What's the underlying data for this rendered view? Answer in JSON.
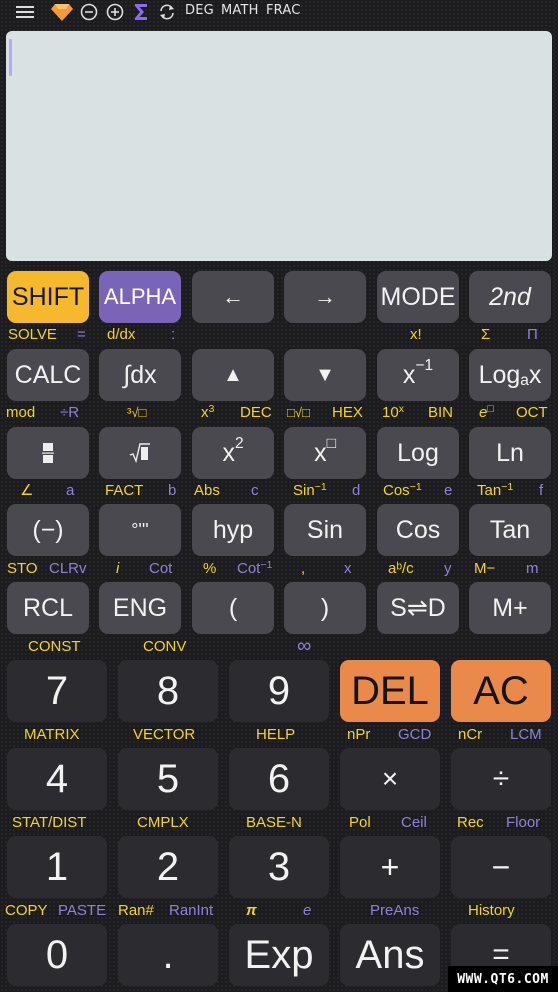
{
  "topbar": {
    "icons": [
      "menu-icon",
      "premium-gem-icon",
      "zoom-out-icon",
      "zoom-in-icon",
      "sigma-icon",
      "refresh-icon"
    ],
    "mode_angle": "DEG",
    "mode_input": "MATH",
    "mode_output": "FRAC"
  },
  "display": {
    "value": ""
  },
  "row1": {
    "keys": [
      "SHIFT",
      "ALPHA",
      "←",
      "→",
      "MODE",
      "2nd"
    ],
    "labels": {
      "solve": "SOLVE",
      "eq": "=",
      "ddx": "d/dx",
      "colon": ":",
      "fact": "x!",
      "sum": "Σ",
      "prod": "Π"
    }
  },
  "row2": {
    "keys": {
      "calc": "CALC",
      "integ": "∫dx",
      "up": "▲",
      "down": "▼",
      "inv_base": "x",
      "inv_exp": "−1",
      "loga_base": "Log",
      "loga_sub": "a",
      "loga_x": "x"
    },
    "labels": {
      "mod": "mod",
      "divr": "÷R",
      "cbrt": "³√□",
      "cube_base": "x",
      "cube_exp": "3",
      "dec": "DEC",
      "nroot": "□√□",
      "hex": "HEX",
      "ten_base": "10",
      "ten_exp": "x",
      "bin": "BIN",
      "e_base": "e",
      "e_exp": "□",
      "oct": "OCT"
    }
  },
  "row3": {
    "keys": {
      "frac": "▪",
      "sqrt": "√▪",
      "sq_base": "x",
      "sq_exp": "2",
      "pow_base": "x",
      "pow_exp": "□",
      "log": "Log",
      "ln": "Ln"
    },
    "labels": {
      "angle": "∠",
      "a": "a",
      "fact": "FACT",
      "b": "b",
      "abs": "Abs",
      "c": "c",
      "asin": "Sin",
      "d": "d",
      "acos": "Cos",
      "e": "e",
      "atan": "Tan",
      "f": "f",
      "inv": "−1"
    }
  },
  "row4": {
    "keys": [
      "(−)",
      "°'''",
      "hyp",
      "Sin",
      "Cos",
      "Tan"
    ],
    "labels": {
      "sto": "STO",
      "clrv": "CLRv",
      "i": "i",
      "cot": "Cot",
      "pct": "%",
      "acot": "Cot",
      "acot_exp": "−1",
      "comma": ",",
      "x": "x",
      "abc": "aᵇ/c",
      "y": "y",
      "mminus": "M−",
      "m": "m"
    }
  },
  "row5": {
    "keys": [
      "RCL",
      "ENG",
      "(",
      ")",
      "S⇌D",
      "M+"
    ],
    "labels": {
      "const": "CONST",
      "conv": "CONV",
      "inf": "∞"
    }
  },
  "row6": {
    "keys": [
      "7",
      "8",
      "9",
      "DEL",
      "AC"
    ],
    "labels": {
      "matrix": "MATRIX",
      "vector": "VECTOR",
      "help": "HELP",
      "npr": "nPr",
      "gcd": "GCD",
      "ncr": "nCr",
      "lcm": "LCM"
    }
  },
  "row7": {
    "keys": [
      "4",
      "5",
      "6",
      "×",
      "÷"
    ],
    "labels": {
      "stat": "STAT/DIST",
      "cmplx": "CMPLX",
      "basen": "BASE-N",
      "pol": "Pol",
      "ceil": "Ceil",
      "rec": "Rec",
      "floor": "Floor"
    }
  },
  "row8": {
    "keys": [
      "1",
      "2",
      "3",
      "+",
      "−"
    ],
    "labels": {
      "copy": "COPY",
      "paste": "PASTE",
      "ran": "Ran#",
      "ranint": "RanInt",
      "pi": "π",
      "e": "e",
      "preans": "PreAns",
      "history": "History"
    }
  },
  "row9": {
    "keys": [
      "0",
      ".",
      "Exp",
      "Ans",
      "="
    ]
  },
  "watermark": "WWW.QT6.COM",
  "colors": {
    "shift": "#f6b82d",
    "alpha": "#7a64b8",
    "orange": "#ea8a4a",
    "shift_label": "#f2d526",
    "alpha_label": "#8d82d6",
    "display_bg": "#d8e2e3"
  }
}
